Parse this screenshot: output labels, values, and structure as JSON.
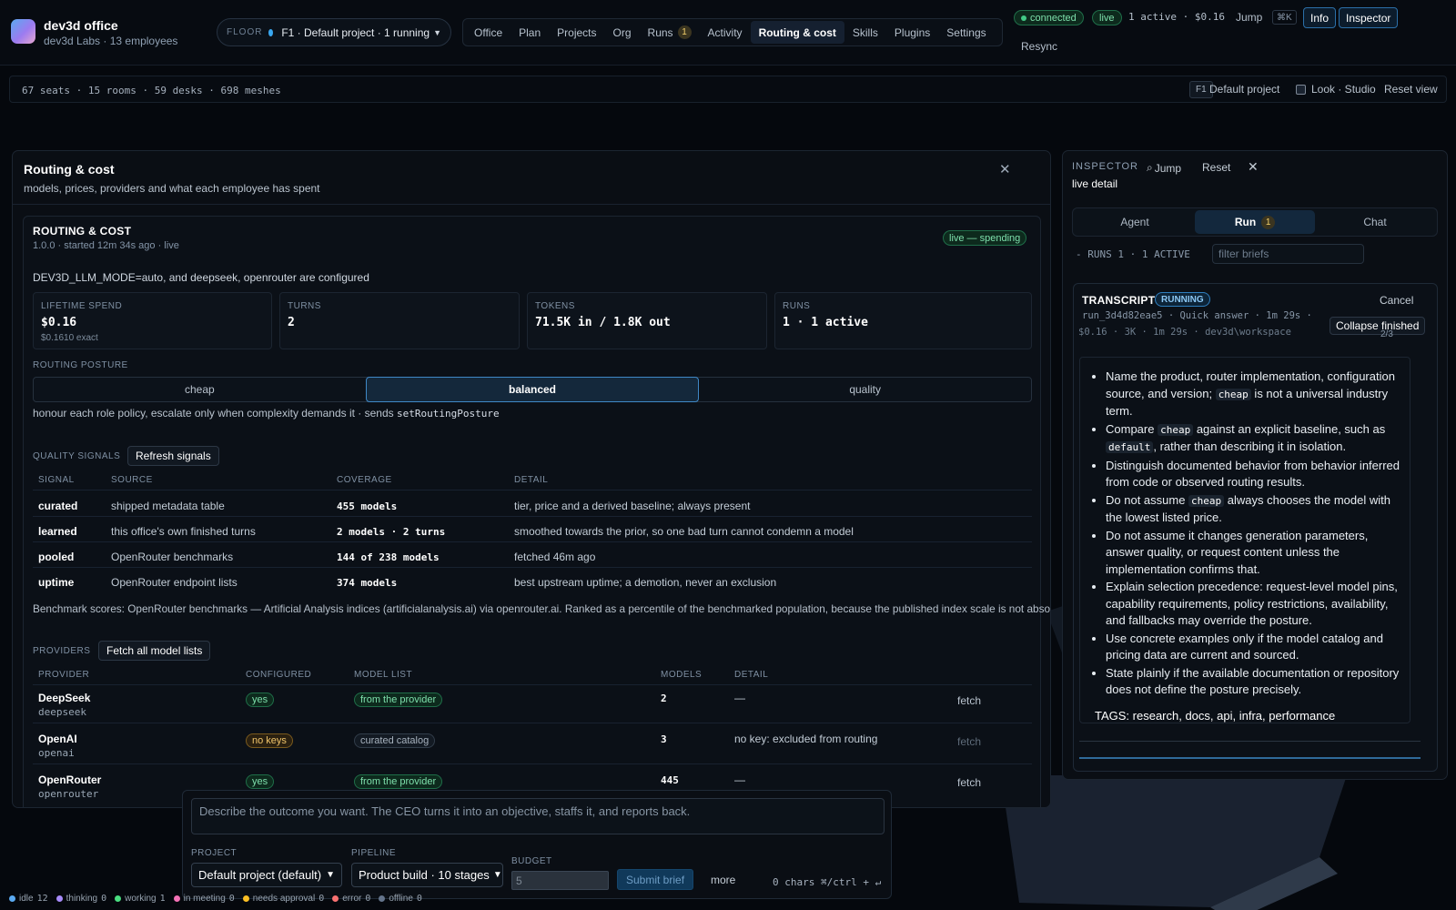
{
  "app": {
    "title": "dev3d office",
    "subtitle": "dev3d Labs · 13 employees"
  },
  "floor": {
    "label": "FLOOR",
    "value": "F1 · Default project · 1 running"
  },
  "nav": [
    {
      "label": "Office",
      "active": false
    },
    {
      "label": "Plan",
      "active": false
    },
    {
      "label": "Projects",
      "active": false
    },
    {
      "label": "Org",
      "active": false
    },
    {
      "label": "Runs",
      "active": false,
      "badge": "1"
    },
    {
      "label": "Activity",
      "active": false
    },
    {
      "label": "Routing & cost",
      "active": true
    },
    {
      "label": "Skills",
      "active": false
    },
    {
      "label": "Plugins",
      "active": false
    },
    {
      "label": "Settings",
      "active": false
    }
  ],
  "topbar": {
    "connected": "connected",
    "live": "live",
    "summary": "1 active · $0.16",
    "jump": "Jump",
    "jump_kbd": "⌘K",
    "info_btn": "Info",
    "inspector_btn": "Inspector",
    "resync": "Resync"
  },
  "infobar": {
    "stats": "67 seats · 15 rooms · 59 desks · 698 meshes",
    "floor_tag": "F1",
    "project": "Default project",
    "look": "Look · Studio",
    "reset": "Reset view"
  },
  "panel": {
    "title": "Routing & cost",
    "subtitle": "models, prices, providers and what each employee has spent",
    "close": "✕"
  },
  "routing": {
    "heading": "ROUTING & COST",
    "meta": "1.0.0 · started 12m 34s ago · live",
    "status": "live — spending",
    "mode_line": "DEV3D_LLM_MODE=auto, and deepseek, openrouter are configured",
    "stats": {
      "spend": {
        "label": "LIFETIME SPEND",
        "value": "$0.16",
        "extra": "$0.1610 exact"
      },
      "turns": {
        "label": "TURNS",
        "value": "2"
      },
      "tokens": {
        "label": "TOKENS",
        "value": "71.5K in / 1.8K out"
      },
      "runs": {
        "label": "RUNS",
        "value": "1 · 1 active"
      }
    },
    "posture": {
      "label": "ROUTING POSTURE",
      "options": [
        {
          "label": "cheap",
          "active": false
        },
        {
          "label": "balanced",
          "active": true
        },
        {
          "label": "quality",
          "active": false
        }
      ],
      "note": "honour each role policy, escalate only when complexity demands it · sends",
      "code": "setRoutingPosture"
    },
    "signals": {
      "label": "QUALITY SIGNALS",
      "refresh": "Refresh signals",
      "headers": [
        "SIGNAL",
        "SOURCE",
        "COVERAGE",
        "DETAIL"
      ],
      "rows": [
        {
          "signal": "curated",
          "source": "shipped metadata table",
          "coverage": "455 models",
          "detail": "tier, price and a derived baseline; always present"
        },
        {
          "signal": "learned",
          "source": "this office's own finished turns",
          "coverage": "2 models · 2 turns",
          "detail": "smoothed towards the prior, so one bad turn cannot condemn a model"
        },
        {
          "signal": "pooled",
          "source": "OpenRouter benchmarks",
          "coverage": "144 of 238 models",
          "detail": "fetched 46m ago"
        },
        {
          "signal": "uptime",
          "source": "OpenRouter endpoint lists",
          "coverage": "374 models",
          "detail": "best upstream uptime; a demotion, never an exclusion"
        }
      ],
      "note": "Benchmark scores: OpenRouter benchmarks — Artificial Analysis indices (artificialanalysis.ai) via openrouter.ai. Ranked as a percentile of the benchmarked population, because the published index scale is not absolute."
    },
    "providers": {
      "label": "PROVIDERS",
      "fetch_all": "Fetch all model lists",
      "headers": [
        "PROVIDER",
        "CONFIGURED",
        "MODEL LIST",
        "MODELS",
        "DETAIL"
      ],
      "rows": [
        {
          "name": "DeepSeek",
          "id": "deepseek",
          "configured": "yes",
          "list": "from the provider",
          "models": "2",
          "detail": "—",
          "action": "fetch"
        },
        {
          "name": "OpenAI",
          "id": "openai",
          "configured": "no keys",
          "list": "curated catalog",
          "models": "3",
          "detail": "no key: excluded from routing",
          "action": "fetch"
        },
        {
          "name": "OpenRouter",
          "id": "openrouter",
          "configured": "yes",
          "list": "from the provider",
          "models": "445",
          "detail": "—",
          "action": "fetch"
        }
      ]
    }
  },
  "inspector": {
    "title": "INSPECTOR",
    "jump": "Jump",
    "reset": "Reset",
    "close": "✕",
    "subtitle": "live detail",
    "tabs": [
      {
        "label": "Agent",
        "active": false
      },
      {
        "label": "Run",
        "active": true,
        "badge": "1"
      },
      {
        "label": "Chat",
        "active": false
      }
    ],
    "runs_label": "- RUNS 1 · 1 ACTIVE",
    "filter_placeholder": "filter briefs",
    "transcript": {
      "title": "TRANSCRIPT",
      "status": "RUNNING",
      "cancel": "Cancel",
      "meta": "run_3d4d82eae5 · Quick answer · 1m 29s ·",
      "path": "$0.16 · 3K · 1m 29s · dev3d\\workspace",
      "collapse": "Collapse finished",
      "page": "2/3",
      "items": [
        [
          "Name the product, router implementation, configuration source, and version; ",
          {
            "code": "cheap"
          },
          " is not a universal industry term."
        ],
        [
          "Compare ",
          {
            "code": "cheap"
          },
          " against an explicit baseline, such as ",
          {
            "code": "default"
          },
          ", rather than describing it in isolation."
        ],
        [
          "Distinguish documented behavior from behavior inferred from code or observed routing results."
        ],
        [
          "Do not assume ",
          {
            "code": "cheap"
          },
          " always chooses the model with the lowest listed price."
        ],
        [
          "Do not assume it changes generation parameters, answer quality, or request content unless the implementation confirms that."
        ],
        [
          "Explain selection precedence: request-level model pins, capability requirements, policy restrictions, availability, and fallbacks may override the posture."
        ],
        [
          "Use concrete examples only if the model catalog and pricing data are current and sourced."
        ],
        [
          "State plainly if the available documentation or repository does not define the posture precisely."
        ]
      ],
      "tags": "TAGS: research, docs, api, infra, performance"
    }
  },
  "brief": {
    "placeholder": "Describe the outcome you want. The CEO turns it into an objective, staffs it, and reports back.",
    "project_label": "PROJECT",
    "project_value": "Default project (default)",
    "pipeline_label": "PIPELINE",
    "pipeline_value": "Product build · 10 stages",
    "budget_label": "BUDGET",
    "budget_placeholder": "5",
    "submit": "Submit brief",
    "more": "more",
    "chars": "0 chars ⌘/ctrl + ↵"
  },
  "legend": [
    {
      "label": "idle",
      "count": "12",
      "color": "#5aa9f0"
    },
    {
      "label": "thinking",
      "count": "0",
      "color": "#a78bfa"
    },
    {
      "label": "working",
      "count": "1",
      "color": "#4ade80"
    },
    {
      "label": "in meeting",
      "count": "0",
      "color": "#f472b6"
    },
    {
      "label": "needs approval",
      "count": "0",
      "color": "#fbbf24"
    },
    {
      "label": "error",
      "count": "0",
      "color": "#f87171"
    },
    {
      "label": "offline",
      "count": "0",
      "color": "#64748b"
    }
  ],
  "colors": {
    "accent": "#3f88c6",
    "live_green": "#7ee0ac",
    "warn_amber": "#f0c46a",
    "background": "#05080d"
  }
}
